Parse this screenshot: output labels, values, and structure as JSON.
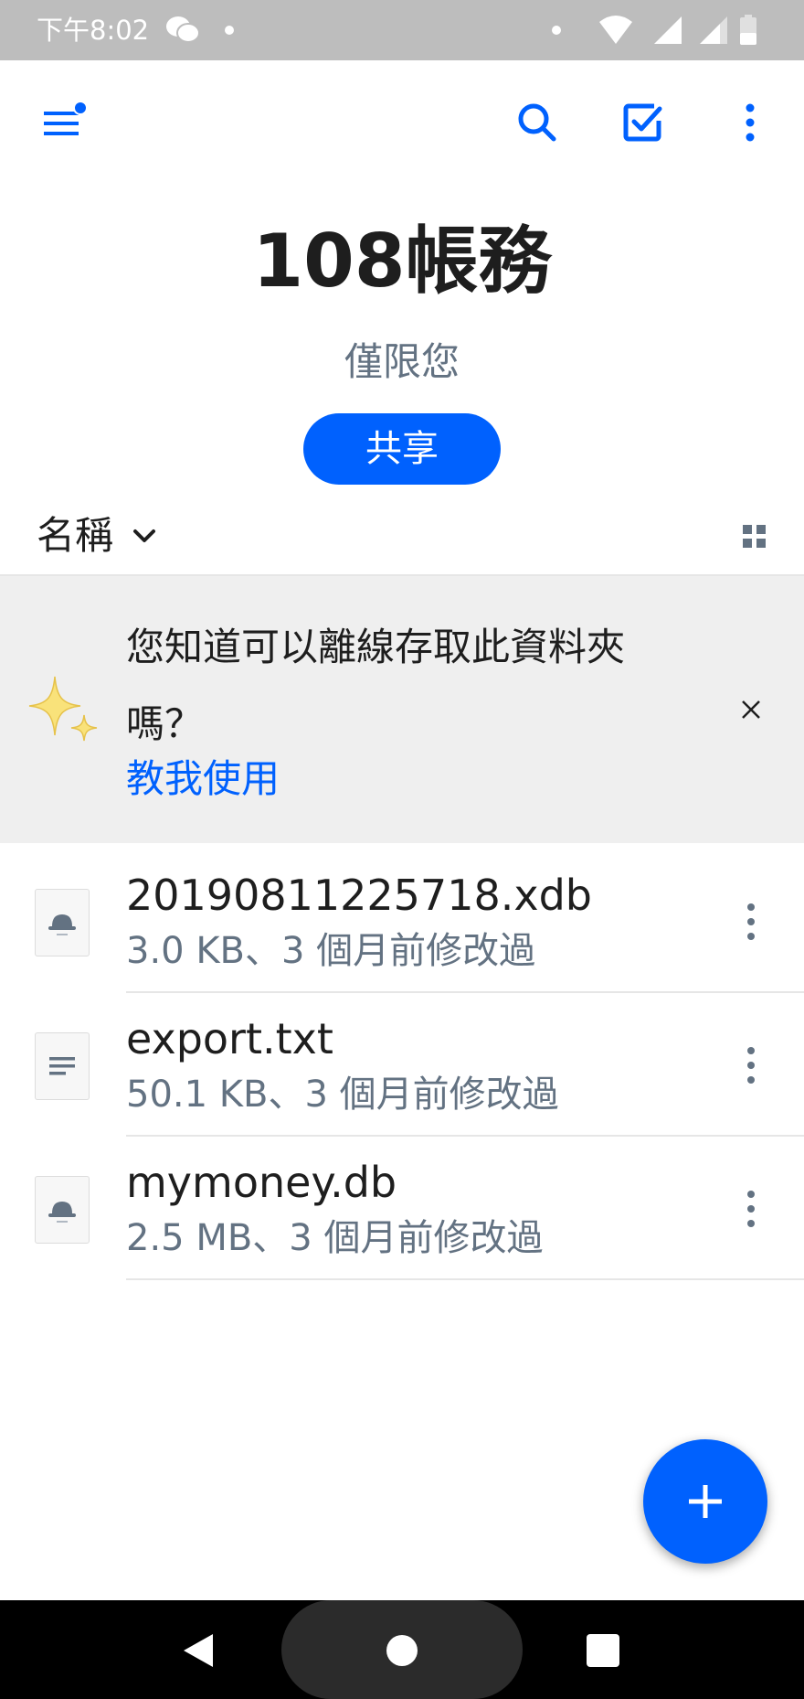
{
  "status_bar": {
    "time": "下午8:02"
  },
  "toolbar": {
    "menu_icon": "menu-notification-icon",
    "search_icon": "search-icon",
    "select_icon": "checkbox-icon",
    "more_icon": "more-vert-icon"
  },
  "folder": {
    "title": "108帳務",
    "subtitle": "僅限您",
    "share_label": "共享"
  },
  "sort": {
    "label": "名稱",
    "view_toggle_icon": "grid-view-icon"
  },
  "tip": {
    "text_line1": "您知道可以離線存取此資料夾",
    "text_line2": "嗎？",
    "link_label": "教我使用"
  },
  "files": [
    {
      "name": "20190811225718.xdb",
      "meta": "3.0 KB、3 個月前修改過",
      "icon": "database-file-icon"
    },
    {
      "name": "export.txt",
      "meta": "50.1 KB、3 個月前修改過",
      "icon": "text-file-icon"
    },
    {
      "name": "mymoney.db",
      "meta": "2.5 MB、3 個月前修改過",
      "icon": "database-file-icon"
    }
  ],
  "colors": {
    "accent": "#0061fe",
    "text_primary": "#1e1e1e",
    "text_secondary": "#637282",
    "banner_bg": "#efefef",
    "status_bar_bg": "#bdbdbd"
  }
}
